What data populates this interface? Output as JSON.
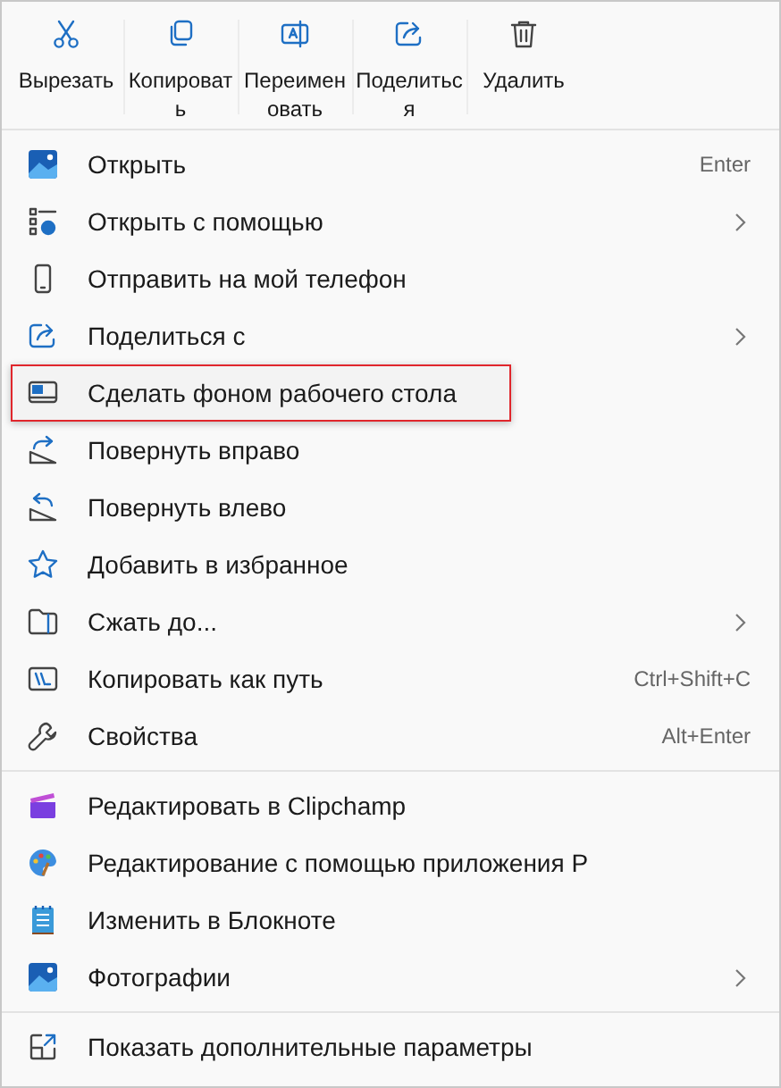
{
  "toolbar": [
    {
      "label": "Вырезать"
    },
    {
      "label": "Копировать"
    },
    {
      "label": "Переименовать"
    },
    {
      "label": "Поделиться"
    },
    {
      "label": "Удалить"
    }
  ],
  "menu_groups": [
    {
      "items": [
        {
          "label": "Открыть",
          "shortcut": "Enter",
          "submenu": false,
          "highlighted": false
        },
        {
          "label": "Открыть с помощью",
          "submenu": true,
          "highlighted": false
        },
        {
          "label": "Отправить на мой телефон",
          "submenu": false,
          "highlighted": false
        },
        {
          "label": "Поделиться с",
          "submenu": true,
          "highlighted": false
        },
        {
          "label": "Сделать фоном рабочего стола",
          "submenu": false,
          "highlighted": true
        },
        {
          "label": "Повернуть вправо",
          "submenu": false,
          "highlighted": false
        },
        {
          "label": "Повернуть влево",
          "submenu": false,
          "highlighted": false
        },
        {
          "label": "Добавить в избранное",
          "submenu": false,
          "highlighted": false
        },
        {
          "label": "Сжать до...",
          "submenu": true,
          "highlighted": false
        },
        {
          "label": "Копировать как путь",
          "shortcut": "Ctrl+Shift+C",
          "submenu": false,
          "highlighted": false
        },
        {
          "label": "Свойства",
          "shortcut": "Alt+Enter",
          "submenu": false,
          "highlighted": false
        }
      ]
    },
    {
      "items": [
        {
          "label": "Редактировать в Clipchamp",
          "submenu": false,
          "highlighted": false
        },
        {
          "label": "Редактирование с помощью приложения P",
          "submenu": false,
          "highlighted": false
        },
        {
          "label": "Изменить в Блокноте",
          "submenu": false,
          "highlighted": false
        },
        {
          "label": "Фотографии",
          "submenu": true,
          "highlighted": false
        }
      ]
    },
    {
      "items": [
        {
          "label": "Показать дополнительные параметры",
          "submenu": false,
          "highlighted": false
        }
      ]
    }
  ]
}
